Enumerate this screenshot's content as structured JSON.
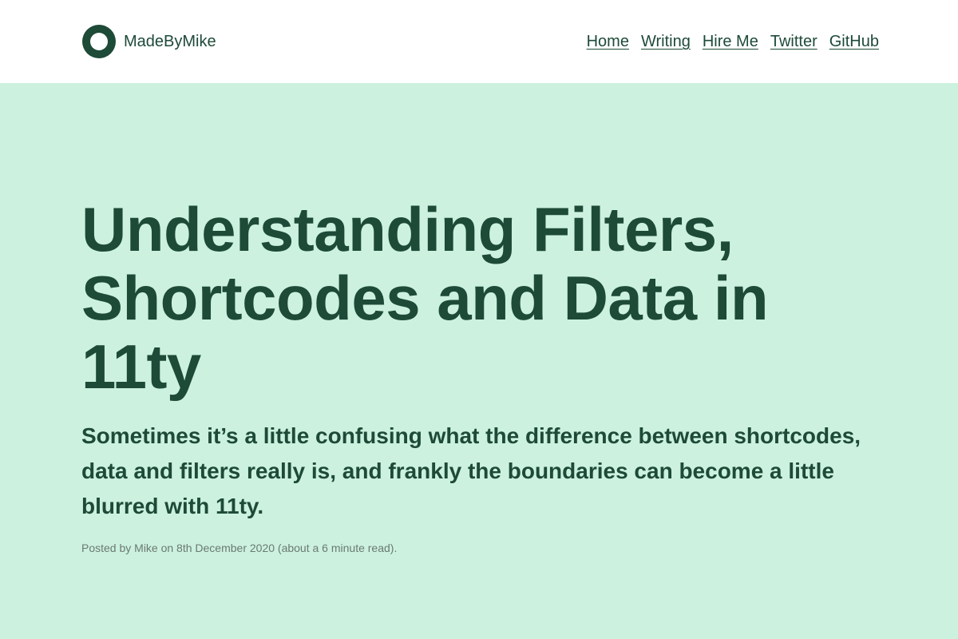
{
  "site": {
    "name": "MadeByMike"
  },
  "nav": {
    "items": [
      {
        "label": "Home"
      },
      {
        "label": "Writing"
      },
      {
        "label": "Hire Me"
      },
      {
        "label": "Twitter"
      },
      {
        "label": "GitHub"
      }
    ]
  },
  "article": {
    "title": "Understanding Filters, Shortcodes and Data in 11ty",
    "lede": "Sometimes it’s a little confusing what the difference between shortcodes, data and filters really is, and frankly the boundaries can become a little blurred with 11ty.",
    "meta": "Posted by Mike on 8th December 2020 (about a 6 minute read)."
  },
  "colors": {
    "brand": "#1e4a38",
    "hero_background": "#ccf1df",
    "meta_text": "#6b7a72"
  },
  "icons": {
    "logo": "ring-logo-icon"
  }
}
